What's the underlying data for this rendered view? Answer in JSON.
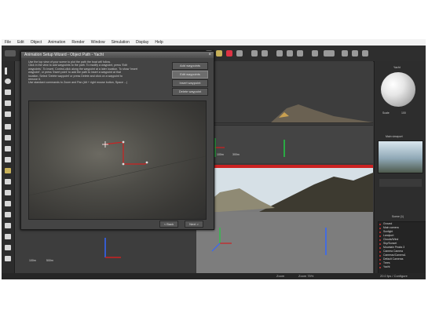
{
  "app": {
    "menu": [
      "File",
      "Edit",
      "Object",
      "Animation",
      "Render",
      "Window",
      "Simulation",
      "Display",
      "Help"
    ]
  },
  "wizard": {
    "title": "Animation Setup Wizard - Object Path - Yacht",
    "close_glyph": "×",
    "instructions": "Use the top view of your scene to plot the path the boat will follow.\nClick in the view to add waypoints to the path. To modify a waypoint, press 'Edit\nwaypoints'. To insert, Control-click along the waypoint at a later location. To show 'Insert\nwaypoint', or press 'Insert point' to add the path to insert a waypoint at that\nlocation. Select 'Delete waypoint' or press Delete and click on a waypoint to\nremove it.\nUse standard commands to Zoom and Pan (Alt + right mouse button, Space ...)",
    "side_buttons": [
      "Add waypoints",
      "Edit waypoints",
      "Insert waypoint",
      "Delete waypoint"
    ],
    "footer_buttons": [
      "< Back",
      "Next >"
    ]
  },
  "right_panel": {
    "material_label": "Yacht",
    "thumb_label": "Main viewport",
    "scale_label": "Scale",
    "scale_value": "100",
    "scene_header": "Scene (1)",
    "scene_items": [
      "Ground",
      "Main camera",
      "Sunlight",
      "Landport",
      "Clouds/Wind",
      "Sky/Sunset",
      "Mountain Peaks 3",
      "Camera Camera",
      "Cameras/Camera1",
      "Default Cameras",
      "Trees",
      "Yacht"
    ]
  },
  "viewports": {
    "bl_scale_left": "100m",
    "bl_scale_right": "500m",
    "tr_scale_left": "100m",
    "tr_scale_right": "300m",
    "vp_size_label": "50 m"
  },
  "status": {
    "left": "",
    "mid1": "Zoom",
    "mid2": "Zoom 75%",
    "right": "20.0 fps / Configure"
  },
  "colors": {
    "accent_red": "#cc2222",
    "axis_green": "#22cc44",
    "axis_blue": "#3366ff"
  }
}
